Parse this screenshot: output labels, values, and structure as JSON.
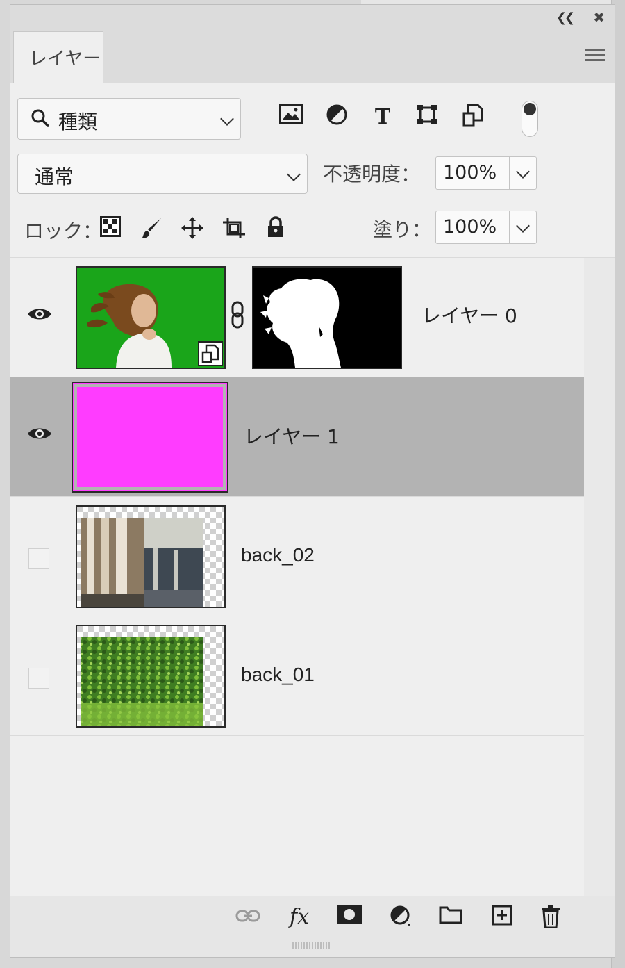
{
  "window": {
    "collapse_icon": "double-chevron-left-icon",
    "close_icon": "close-icon"
  },
  "tab": {
    "label": "レイヤー"
  },
  "filter": {
    "kind_label": "種類",
    "icons": [
      "image-filter-icon",
      "adjustment-filter-icon",
      "type-filter-icon",
      "shape-filter-icon",
      "smart-object-filter-icon"
    ]
  },
  "blend": {
    "mode": "通常",
    "opacity_label": "不透明度：",
    "opacity_value": "100%"
  },
  "lock": {
    "label": "ロック：",
    "icons": [
      "lock-transparent-pixels-icon",
      "lock-image-pixels-icon",
      "lock-position-icon",
      "lock-artboard-icon",
      "lock-all-icon"
    ],
    "fill_label": "塗り：",
    "fill_value": "100%"
  },
  "layers": [
    {
      "name": "レイヤー 0",
      "visible": true,
      "selected": false,
      "thumb": "green-screen-woman",
      "has_mask": true,
      "smart_object": true
    },
    {
      "name": "レイヤー 1",
      "visible": true,
      "selected": true,
      "thumb": "magenta-fill",
      "color": "#ff3cff"
    },
    {
      "name": "back_02",
      "visible": false,
      "selected": false,
      "thumb": "building-columns"
    },
    {
      "name": "back_01",
      "visible": false,
      "selected": false,
      "thumb": "green-foliage"
    }
  ],
  "footer": {
    "icons": [
      "link-layers-icon",
      "fx-icon",
      "add-mask-icon",
      "new-adjustment-layer-icon",
      "new-group-icon",
      "new-layer-icon",
      "delete-layer-icon"
    ]
  },
  "colors": {
    "selected_row": "#b3b3b3",
    "panel": "#efefef",
    "magenta": "#ff3cff",
    "green_screen": "#1aa51a"
  }
}
